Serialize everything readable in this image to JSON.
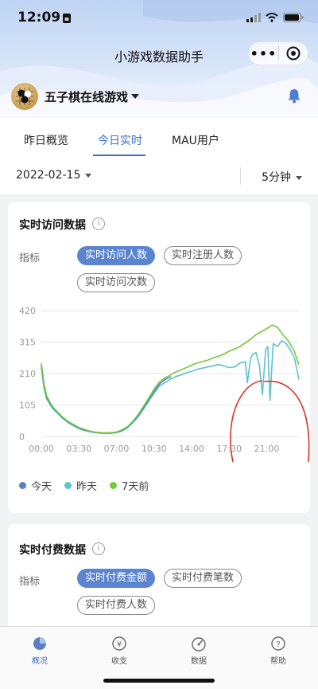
{
  "status_bar": {
    "time": "12:09"
  },
  "app": {
    "title": "小游戏数据助手",
    "more_glyph": "•••"
  },
  "game": {
    "name": "五子棋在线游戏"
  },
  "tabs": [
    {
      "label": "昨日概览",
      "active": false
    },
    {
      "label": "今日实时",
      "active": true
    },
    {
      "label": "MAU用户",
      "active": false
    }
  ],
  "filters": {
    "date": "2022-02-15",
    "interval": "5分钟"
  },
  "card_visits": {
    "title": "实时访问数据",
    "info": "i",
    "metric_label": "指标",
    "chips": [
      {
        "label": "实时访问人数",
        "active": true
      },
      {
        "label": "实时注册人数",
        "active": false
      },
      {
        "label": "实时访问次数",
        "active": false
      }
    ]
  },
  "card_pay": {
    "title": "实时付费数据",
    "info": "i",
    "metric_label": "指标",
    "chips": [
      {
        "label": "实时付费金额",
        "active": true
      },
      {
        "label": "实时付费笔数",
        "active": false
      },
      {
        "label": "实时付费人数",
        "active": false
      }
    ]
  },
  "chart_data": {
    "type": "line",
    "x_ticks": [
      "00:00",
      "03:30",
      "07:00",
      "10:30",
      "14:00",
      "17:30",
      "21:00"
    ],
    "y_ticks": [
      "420",
      "315",
      "210",
      "105",
      "0"
    ],
    "ylim": [
      0,
      420
    ],
    "xlim_hours": [
      0,
      24
    ],
    "grid": true,
    "legend_position": "bottom-left",
    "series": [
      {
        "name": "今天",
        "color": "#5b7fc2",
        "x_hours": [
          0,
          0.25,
          0.5,
          1,
          1.5,
          2,
          2.5,
          3,
          3.5,
          4,
          4.5,
          5,
          5.5,
          6,
          6.5,
          7,
          7.5,
          8,
          8.5,
          9,
          9.5,
          10,
          10.5,
          11,
          11.5,
          12.1
        ],
        "values": [
          240,
          170,
          130,
          100,
          80,
          62,
          48,
          38,
          28,
          22,
          18,
          14,
          12,
          11,
          12,
          14,
          20,
          30,
          48,
          68,
          95,
          120,
          150,
          175,
          190,
          200
        ]
      },
      {
        "name": "昨天",
        "color": "#5bc4cf",
        "x_hours": [
          0,
          0.25,
          0.5,
          1,
          1.5,
          2,
          2.5,
          3,
          3.5,
          4,
          4.5,
          5,
          5.5,
          6,
          6.5,
          7,
          7.5,
          8,
          8.5,
          9,
          9.5,
          10,
          10.5,
          11,
          11.5,
          12,
          12.5,
          13,
          13.5,
          14,
          14.5,
          15,
          15.5,
          16,
          16.5,
          17,
          17.5,
          18,
          18.5,
          19,
          19.2,
          19.5,
          19.7,
          20,
          20.3,
          20.6,
          20.9,
          21.1,
          21.3,
          21.6,
          22,
          22.4,
          22.8,
          23.2,
          23.6,
          24
        ],
        "values": [
          230,
          160,
          125,
          95,
          78,
          60,
          46,
          36,
          26,
          20,
          16,
          13,
          11,
          10,
          11,
          13,
          18,
          28,
          45,
          65,
          90,
          118,
          145,
          168,
          180,
          190,
          200,
          205,
          212,
          218,
          224,
          228,
          232,
          236,
          240,
          236,
          230,
          232,
          245,
          250,
          180,
          262,
          275,
          280,
          240,
          140,
          290,
          300,
          120,
          310,
          300,
          320,
          310,
          290,
          260,
          190
        ]
      },
      {
        "name": "7天前",
        "color": "#72c93b",
        "x_hours": [
          0,
          0.25,
          0.5,
          1,
          1.5,
          2,
          2.5,
          3,
          3.5,
          4,
          4.5,
          5,
          5.5,
          6,
          6.5,
          7,
          7.5,
          8,
          8.5,
          9,
          9.5,
          10,
          10.5,
          11,
          11.5,
          12,
          12.5,
          13,
          13.5,
          14,
          14.5,
          15,
          15.5,
          16,
          16.5,
          17,
          17.5,
          18,
          18.5,
          19,
          19.5,
          20,
          20.5,
          21,
          21.5,
          22,
          22.5,
          23,
          23.5,
          24
        ],
        "values": [
          245,
          175,
          135,
          102,
          82,
          64,
          50,
          40,
          30,
          24,
          18,
          15,
          13,
          12,
          13,
          15,
          22,
          32,
          50,
          72,
          100,
          128,
          158,
          182,
          195,
          205,
          215,
          222,
          230,
          238,
          245,
          250,
          255,
          262,
          268,
          275,
          285,
          292,
          300,
          312,
          325,
          340,
          350,
          360,
          372,
          365,
          340,
          320,
          290,
          240
        ]
      }
    ]
  },
  "bottom_nav": [
    {
      "label": "概况",
      "icon": "pie-chart-icon",
      "active": true
    },
    {
      "label": "收支",
      "icon": "yen-coin-icon",
      "active": false
    },
    {
      "label": "数据",
      "icon": "gauge-icon",
      "active": false
    },
    {
      "label": "帮助",
      "icon": "help-icon",
      "active": false
    }
  ]
}
